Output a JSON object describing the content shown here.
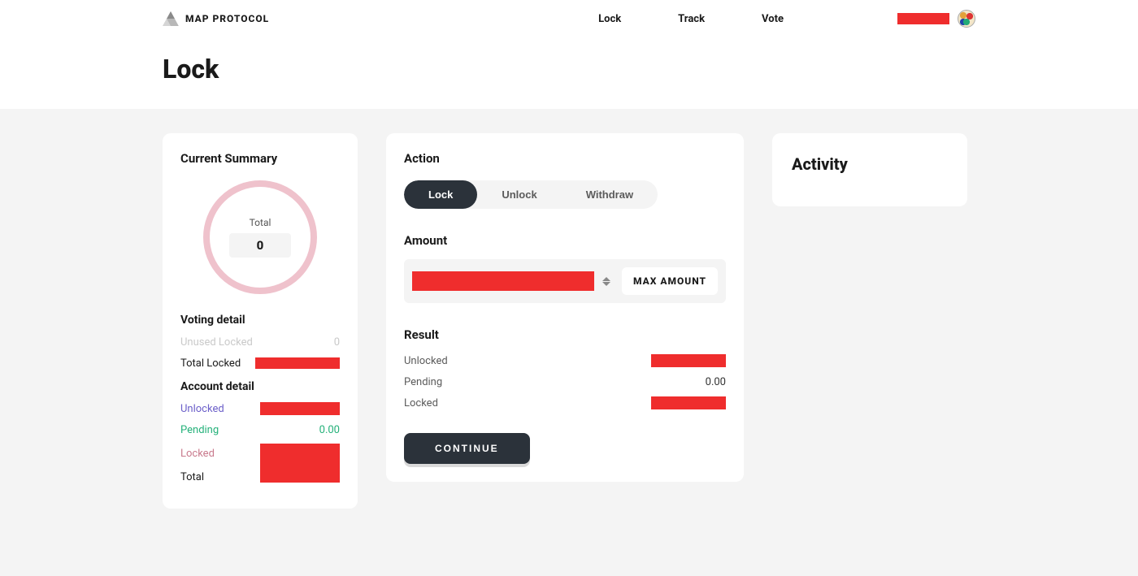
{
  "brand": "MAP PROTOCOL",
  "nav": {
    "lock": "Lock",
    "track": "Track",
    "vote": "Vote"
  },
  "page_title": "Lock",
  "summary": {
    "heading": "Current Summary",
    "ring_label": "Total",
    "ring_value": "0",
    "voting_heading": "Voting detail",
    "unused_locked_label": "Unused Locked",
    "unused_locked_value": "0",
    "total_locked_label": "Total Locked",
    "account_heading": "Account detail",
    "unlocked_label": "Unlocked",
    "pending_label": "Pending",
    "pending_value": "0.00",
    "locked_label": "Locked",
    "total_label": "Total"
  },
  "action": {
    "heading": "Action",
    "tabs": {
      "lock": "Lock",
      "unlock": "Unlock",
      "withdraw": "Withdraw"
    },
    "amount_heading": "Amount",
    "max_label": "MAX AMOUNT",
    "result_heading": "Result",
    "unlocked_label": "Unlocked",
    "pending_label": "Pending",
    "pending_value": "0.00",
    "locked_label": "Locked",
    "continue": "CONTINUE"
  },
  "activity": {
    "heading": "Activity"
  }
}
